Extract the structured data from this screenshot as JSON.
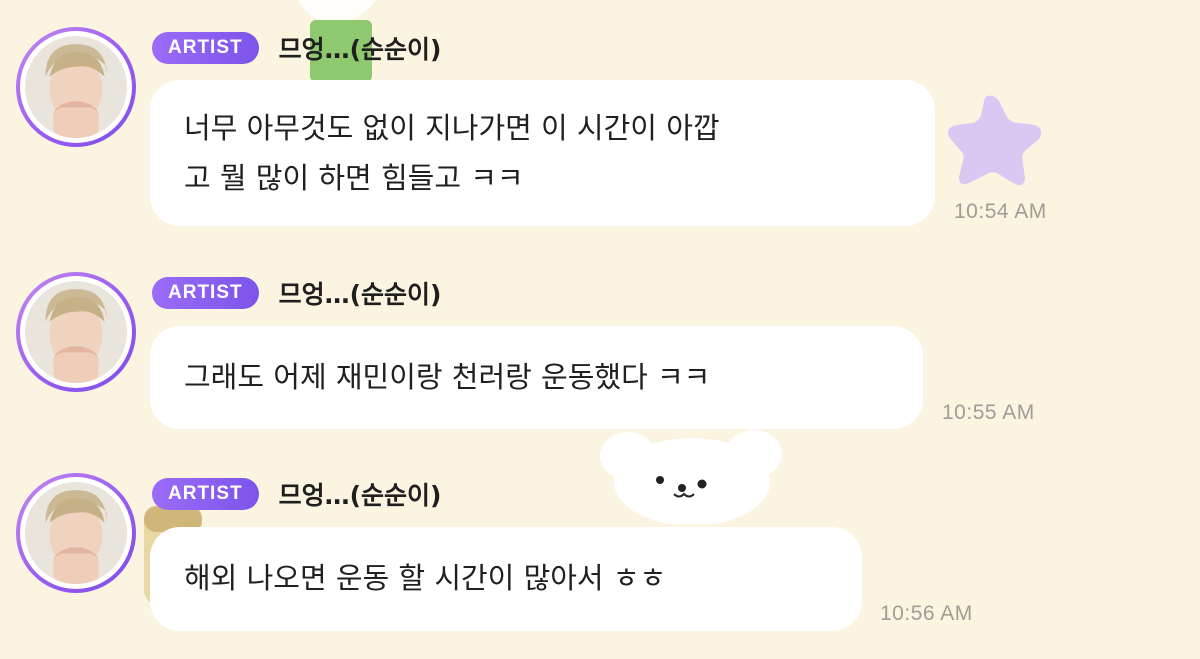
{
  "messages": [
    {
      "badge": "ARTIST",
      "sender": "므엉…(순순이)",
      "lines": [
        "너무 아무것도 없이 지나가면 이 시간이 아깝",
        "고 뭘 많이 하면 힘들고 ㅋㅋ"
      ],
      "time": "10:54 AM"
    },
    {
      "badge": "ARTIST",
      "sender": "므엉…(순순이)",
      "lines": [
        "그래도 어제 재민이랑 천러랑 운동했다 ㅋㅋ"
      ],
      "time": "10:55 AM"
    },
    {
      "badge": "ARTIST",
      "sender": "므엉…(순순이)",
      "lines": [
        "해외 나오면 운동 할 시간이 많아서 ㅎㅎ"
      ],
      "time": "10:56 AM"
    }
  ],
  "colors": {
    "background": "#fbf4e0",
    "badge": "#8a5ef0",
    "avatar_ring": "#a86df2",
    "timestamp": "#a09d98"
  },
  "icons": [
    "star-sticker-icon",
    "puppy-sticker-icon",
    "cup-sticker-icon"
  ]
}
